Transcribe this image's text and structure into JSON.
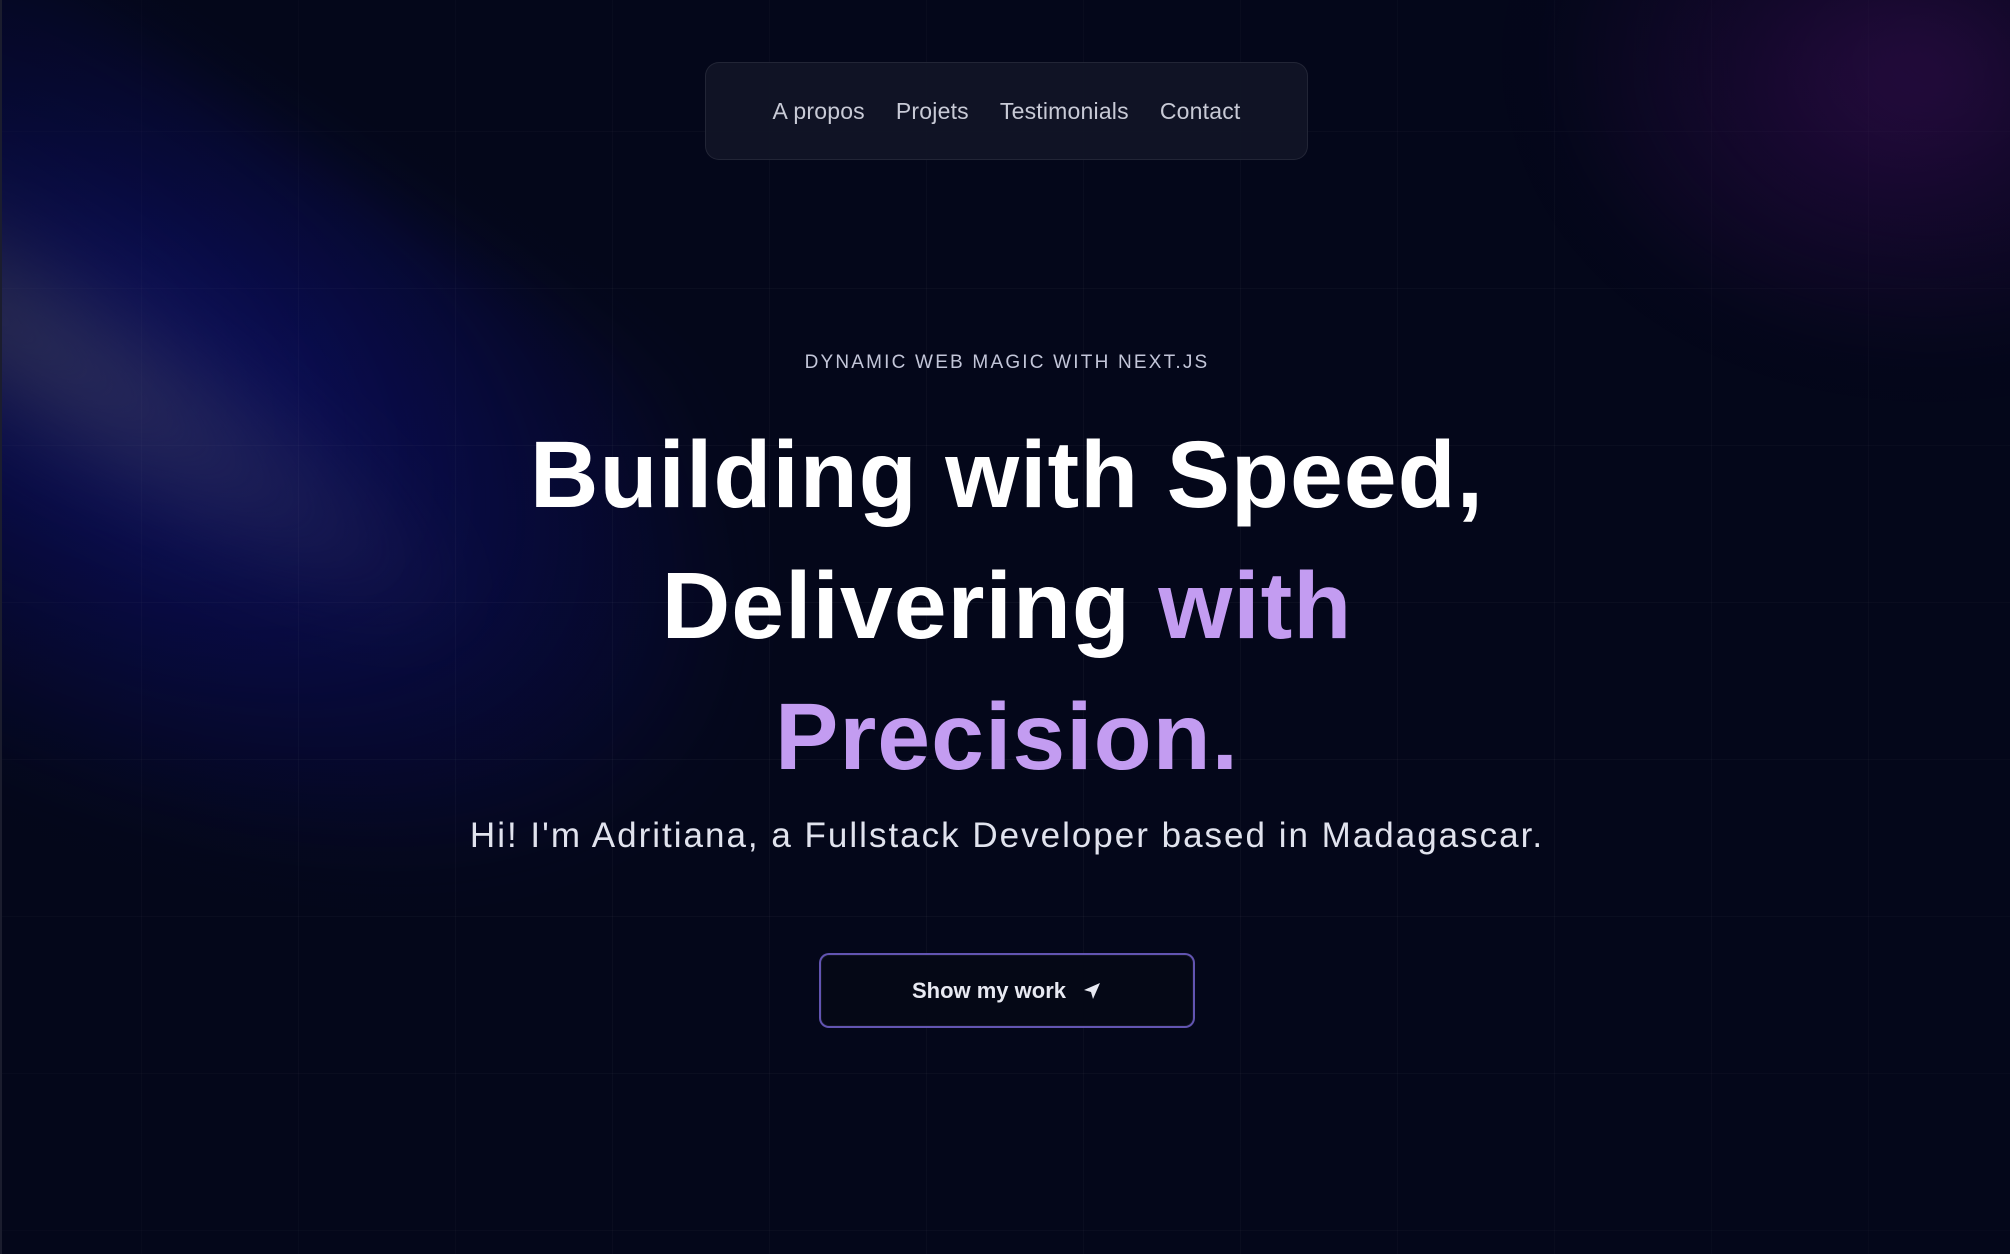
{
  "nav": {
    "items": [
      {
        "label": "A propos"
      },
      {
        "label": "Projets"
      },
      {
        "label": "Testimonials"
      },
      {
        "label": "Contact"
      }
    ]
  },
  "hero": {
    "subtitle": "DYNAMIC WEB MAGIC WITH NEXT.JS",
    "headline_part1": "Building with Speed,",
    "headline_part2": "Delivering",
    "headline_accent": "with Precision.",
    "intro": "Hi! I'm Adritiana, a Fullstack Developer based in Madagascar."
  },
  "cta": {
    "label": "Show my work",
    "icon": "send-icon"
  },
  "colors": {
    "background": "#04071a",
    "accent": "#c39cf1",
    "button_border": "#826ee6"
  }
}
